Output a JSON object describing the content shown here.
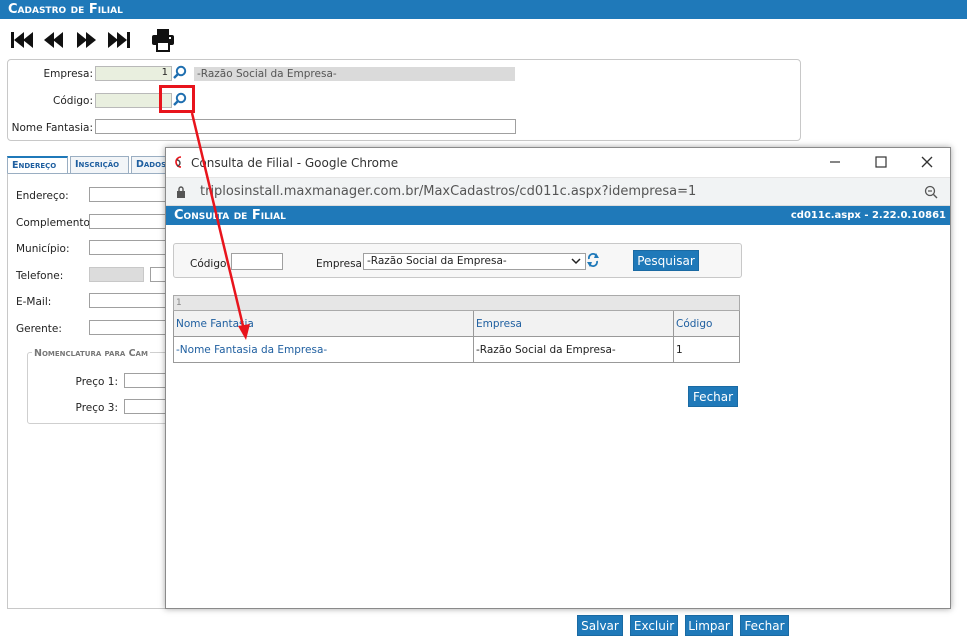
{
  "main": {
    "title": "Cadastro de Filial",
    "fields": {
      "empresa_label": "Empresa:",
      "empresa_value": "1",
      "empresa_razao": "-Razão Social da Empresa-",
      "codigo_label": "Código:",
      "nome_fantasia_label": "Nome Fantasia:"
    },
    "tabs": [
      "Endereço",
      "Inscrição",
      "Dados"
    ],
    "tab_fields": {
      "endereco": "Endereço:",
      "complemento": "Complemento:",
      "municipio": "Município:",
      "telefone": "Telefone:",
      "email": "E-Mail:",
      "gerente": "Gerente:"
    },
    "nomenclatura": {
      "legend": "Nomenclatura para Cam",
      "preco1": "Preço 1:",
      "preco3": "Preço 3:"
    },
    "buttons": {
      "salvar": "Salvar",
      "excluir": "Excluir",
      "limpar": "Limpar",
      "fechar": "Fechar"
    }
  },
  "popup": {
    "window_title": "Consulta de Filial - Google Chrome",
    "url": "triplosinstall.maxmanager.com.br/MaxCadastros/cd011c.aspx?idempresa=1",
    "header_title": "Consulta de Filial",
    "header_version": "cd011c.aspx - 2.22.0.10861",
    "search": {
      "codigo_label": "Código:",
      "codigo_value": "",
      "empresa_label": "Empresa:",
      "empresa_selected": "-Razão Social da Empresa-",
      "pesquisar": "Pesquisar"
    },
    "grid": {
      "pager": "1",
      "columns": [
        "Nome Fantasia",
        "Empresa",
        "Código"
      ],
      "rows": [
        {
          "nome_fantasia": "-Nome Fantasia da Empresa-",
          "empresa": "-Razão Social da Empresa-",
          "codigo": "1"
        }
      ]
    },
    "fechar": "Fechar"
  },
  "colors": {
    "header_blue": "#1f79b9",
    "highlight_red": "#e8141c"
  },
  "icons": [
    "first-record-icon",
    "previous-record-icon",
    "next-record-icon",
    "last-record-icon",
    "printer-icon",
    "search-icon",
    "chrome-icon",
    "lock-icon",
    "zoom-icon",
    "refresh-icon"
  ]
}
